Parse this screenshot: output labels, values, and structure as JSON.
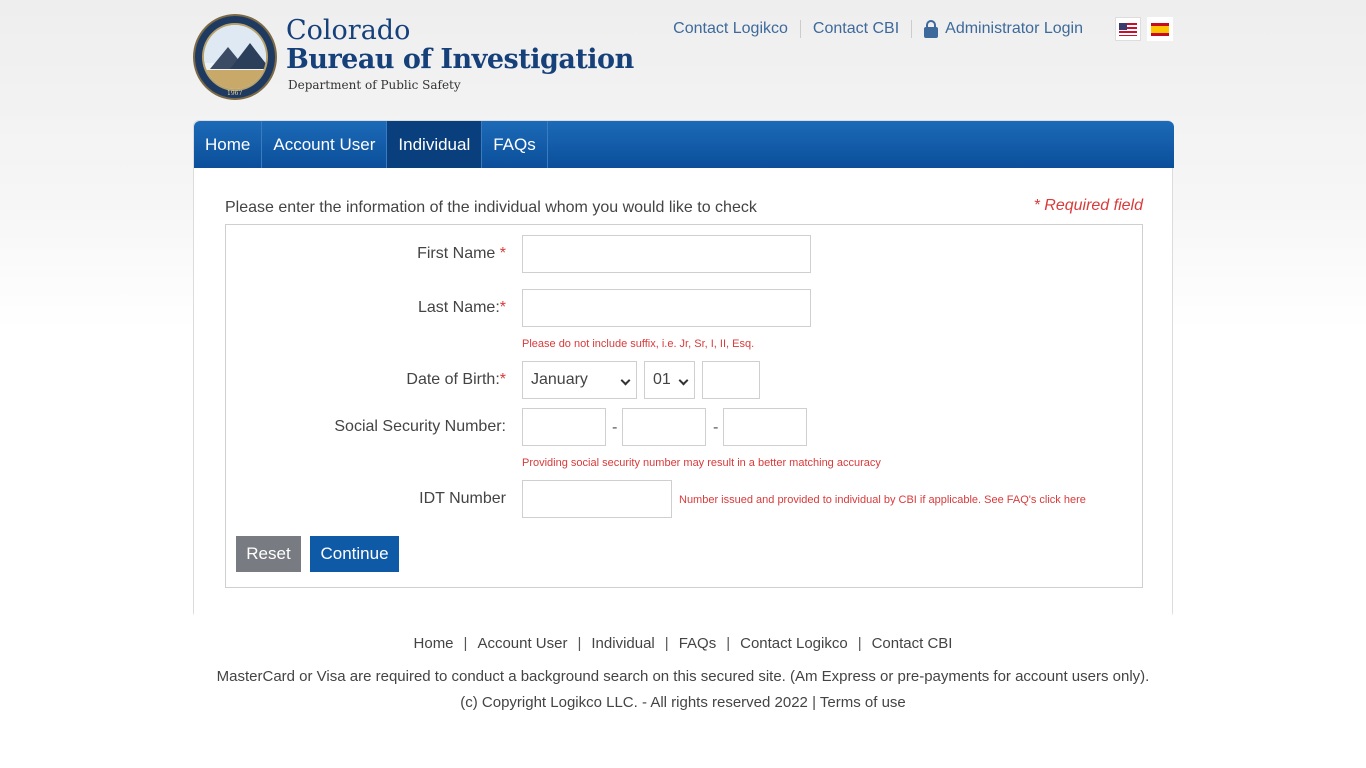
{
  "header": {
    "title_line1": "Colorado",
    "title_line2": "Bureau of Investigation",
    "subtitle": "Department of Public Safety",
    "seal_year": "1967",
    "seal_icon": "cbi-seal-logo",
    "links": {
      "contact_logikco": "Contact Logikco",
      "contact_cbi": "Contact CBI",
      "admin_login": "Administrator Login"
    },
    "lock_icon": "lock-icon",
    "flags": [
      "us-flag-icon",
      "spain-flag-icon"
    ]
  },
  "nav": {
    "items": [
      {
        "label": "Home",
        "active": false
      },
      {
        "label": "Account User",
        "active": false
      },
      {
        "label": "Individual",
        "active": true
      },
      {
        "label": "FAQs",
        "active": false
      }
    ]
  },
  "form": {
    "intro": "Please enter the information of the individual whom you would like to check",
    "required_note": "* Required field",
    "first_name_label": "First Name ",
    "first_name_value": "",
    "last_name_label": "Last Name:",
    "last_name_value": "",
    "suffix_hint": "Please do not include suffix, i.e. Jr, Sr, I, II, Esq.",
    "dob_label": "Date of Birth:",
    "dob_month": "January",
    "dob_day": "01",
    "dob_year": "",
    "ssn_label": "Social Security Number:",
    "ssn_dash": "-",
    "ssn_hint": "Providing social security number may result in a better matching accuracy",
    "idt_label": "IDT Number",
    "idt_hint": "Number issued and provided to individual by CBI if applicable. See FAQ's click here",
    "required_star": "*",
    "reset_label": "Reset",
    "continue_label": "Continue"
  },
  "footer": {
    "links": [
      "Home",
      "Account User",
      "Individual",
      "FAQs",
      "Contact Logikco",
      "Contact CBI"
    ],
    "separator": "|",
    "note": "MasterCard or Visa are required to conduct a background search on this secured site. (Am Express or pre-payments for account users only).",
    "copyright": "(c) Copyright Logikco LLC. - All rights reserved 2022",
    "terms": "Terms of use"
  },
  "colors": {
    "brand_blue": "#16407a",
    "nav_blue": "#0b4f9a",
    "nav_active": "#0a3f7d",
    "error_red": "#d93a3a",
    "button_grey": "#787c82",
    "button_blue": "#0e5aa7"
  }
}
